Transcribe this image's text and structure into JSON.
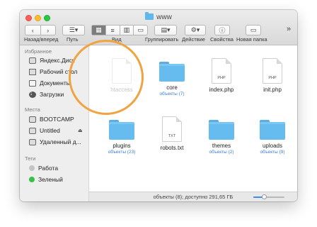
{
  "window": {
    "title": "www",
    "folder_icon": "folder-icon"
  },
  "toolbar": {
    "nav_label": "Назад/вперед",
    "path_label": "Путь",
    "view_label": "Вид",
    "group_label": "Группировать",
    "action_label": "Действие",
    "props_label": "Свойства",
    "new_folder_label": "Новая папка",
    "overflow": "»"
  },
  "sidebar": {
    "favorites_header": "Избранное",
    "favorites": [
      {
        "label": "Яндекс.Диск",
        "icon": "drive-icon"
      },
      {
        "label": "Рабочий стол",
        "icon": "desktop-icon"
      },
      {
        "label": "Документы",
        "icon": "documents-icon"
      },
      {
        "label": "Загрузки",
        "icon": "downloads-icon"
      }
    ],
    "places_header": "Места",
    "places": [
      {
        "label": "BOOTCAMP",
        "icon": "disk-icon"
      },
      {
        "label": "Untitled",
        "icon": "disk-icon"
      },
      {
        "label": "Удаленный д...",
        "icon": "remote-disk-icon"
      }
    ],
    "tags_header": "Теги",
    "tags": [
      {
        "label": "Работа",
        "color": "#c4c4c4"
      },
      {
        "label": "Зеленый",
        "color": "#36c148"
      }
    ]
  },
  "files": [
    {
      "name": "htaccess",
      "type": "doc",
      "ext": "",
      "sub": ""
    },
    {
      "name": "core",
      "type": "folder",
      "sub": "объекты (7)"
    },
    {
      "name": "index.php",
      "type": "doc",
      "ext": "PHP",
      "sub": ""
    },
    {
      "name": "init.php",
      "type": "doc",
      "ext": "PHP",
      "sub": ""
    },
    {
      "name": "plugins",
      "type": "folder",
      "sub": "объекты (23)"
    },
    {
      "name": "robots.txt",
      "type": "doc",
      "ext": "TXT",
      "sub": ""
    },
    {
      "name": "themes",
      "type": "folder",
      "sub": "объекты (2)"
    },
    {
      "name": "uploads",
      "type": "folder",
      "sub": "объекты (9)"
    }
  ],
  "status": {
    "text": "объекты (8); доступно 291,65 ГБ",
    "zoom_level": 0.35
  },
  "colors": {
    "folder": "#66bbef",
    "accent": "#3d8ee8",
    "highlight": "#f2a341"
  }
}
